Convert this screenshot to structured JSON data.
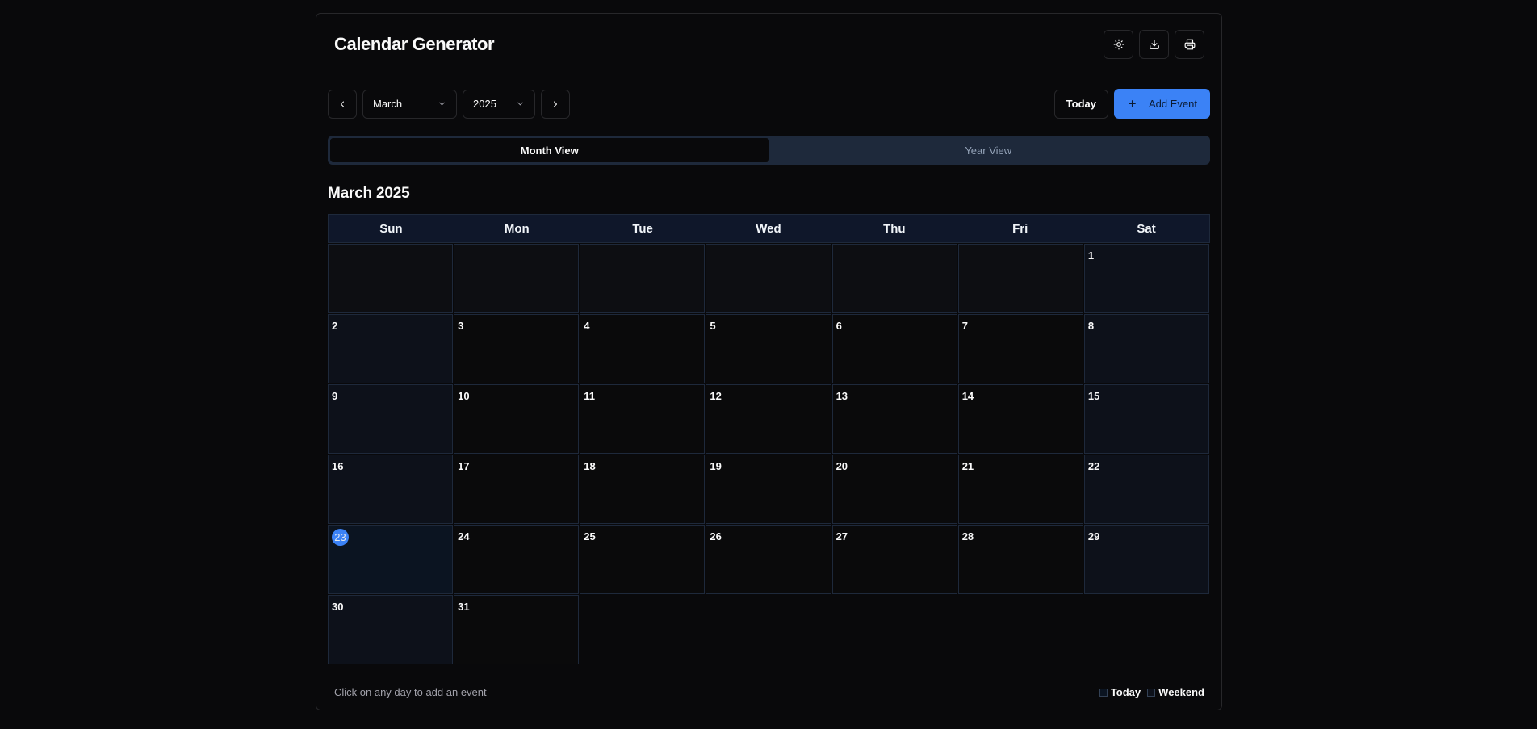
{
  "app": {
    "title": "Calendar Generator"
  },
  "header_actions": [
    {
      "name": "theme-toggle-button",
      "icon": "sun-icon"
    },
    {
      "name": "download-button",
      "icon": "download-icon"
    },
    {
      "name": "print-button",
      "icon": "printer-icon"
    }
  ],
  "toolbar": {
    "prev_icon": "chevron-left-icon",
    "next_icon": "chevron-right-icon",
    "month_value": "March",
    "year_value": "2025",
    "today_label": "Today",
    "add_event_label": "Add Event"
  },
  "tabs": [
    {
      "label": "Month View",
      "active": true
    },
    {
      "label": "Year View",
      "active": false
    }
  ],
  "calendar": {
    "heading": "March 2025",
    "weekdays": [
      "Sun",
      "Mon",
      "Tue",
      "Wed",
      "Thu",
      "Fri",
      "Sat"
    ],
    "leading_empty_days": 6,
    "days_in_month": 31,
    "today": 23
  },
  "footer": {
    "hint": "Click on any day to add an event",
    "legend_today": "Today",
    "legend_weekend": "Weekend"
  },
  "colors": {
    "accent": "#3b82f6",
    "background": "#09090b",
    "border": "#27272a"
  }
}
